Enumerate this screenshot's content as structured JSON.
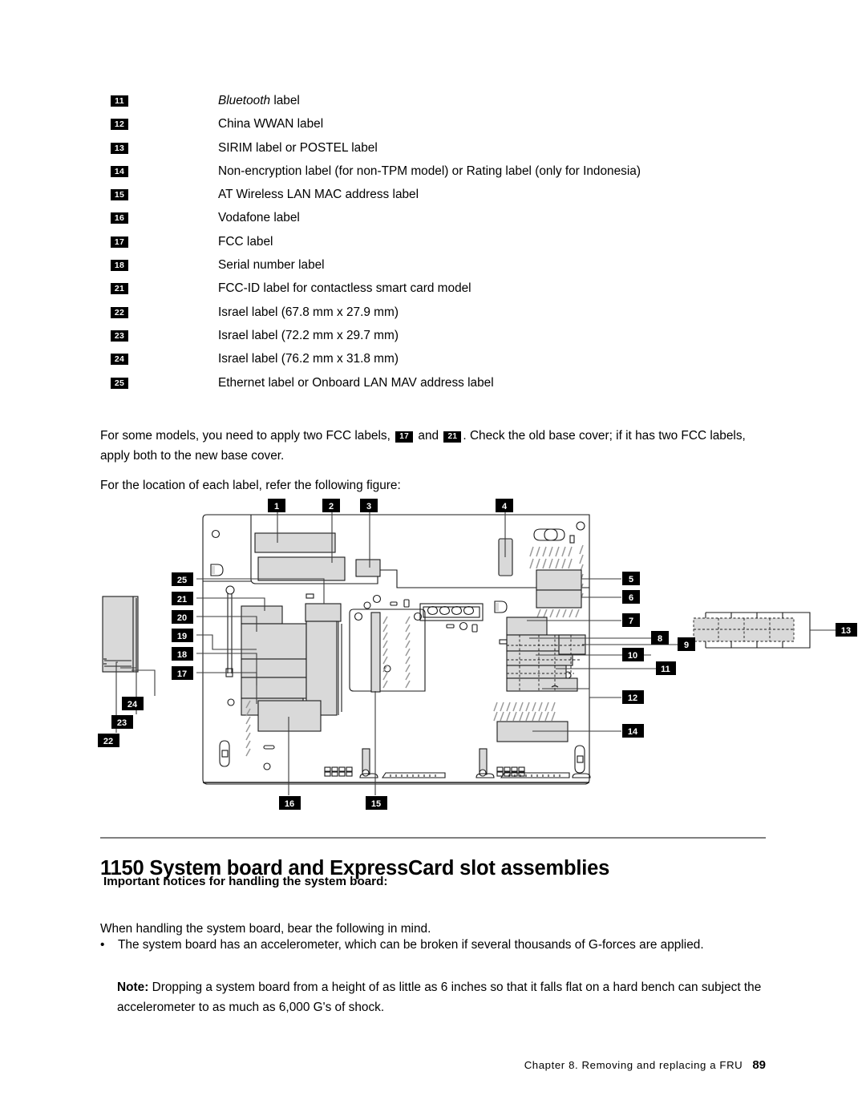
{
  "document": {
    "page_number": "89",
    "footer_text": "Chapter 8.  Removing  and  replacing a FRU"
  },
  "label_list": {
    "rows": [
      {
        "num": "11",
        "text_pre": "",
        "text_italic": "Bluetooth",
        "text_post": " label",
        "text": "Bluetooth label"
      },
      {
        "num": "12",
        "text": "China WWAN label"
      },
      {
        "num": "13",
        "text": "SIRIM label or POSTEL label"
      },
      {
        "num": "14",
        "text": "Non-encryption label (for non-TPM model) or Rating label (only for Indonesia)"
      },
      {
        "num": "15",
        "text": "AT Wireless LAN MAC address label"
      },
      {
        "num": "16",
        "text": "Vodafone label"
      },
      {
        "num": "17",
        "text": "FCC label"
      },
      {
        "num": "18",
        "text": "Serial number label"
      },
      {
        "num": "21",
        "text": "FCC-ID label for contactless smart card model"
      },
      {
        "num": "22",
        "text": "Israel label (67.8 mm x 27.9 mm)"
      },
      {
        "num": "23",
        "text": "Israel label (72.2 mm x 29.7 mm)"
      },
      {
        "num": "24",
        "text": "Israel label (76.2 mm x 31.8 mm)"
      },
      {
        "num": "25",
        "text": "Ethernet label or Onboard LAN MAV address label"
      }
    ]
  },
  "paragraphs": {
    "fcc_part1": "For some models, you need to apply two FCC labels,",
    "fcc_badge_a": "17",
    "fcc_conjunction": "and",
    "fcc_badge_b": "21",
    "fcc_part2": ". Check the old base cover; if it has two FCC labels, apply both to the new base cover.",
    "location": "For the location of each label, refer the following figure:"
  },
  "figure": {
    "callouts": [
      {
        "num": "1"
      },
      {
        "num": "2"
      },
      {
        "num": "3"
      },
      {
        "num": "4"
      },
      {
        "num": "5"
      },
      {
        "num": "6"
      },
      {
        "num": "7"
      },
      {
        "num": "8"
      },
      {
        "num": "9"
      },
      {
        "num": "10"
      },
      {
        "num": "11"
      },
      {
        "num": "12"
      },
      {
        "num": "13"
      },
      {
        "num": "14"
      },
      {
        "num": "15"
      },
      {
        "num": "16"
      },
      {
        "num": "17"
      },
      {
        "num": "18"
      },
      {
        "num": "19"
      },
      {
        "num": "20"
      },
      {
        "num": "21"
      },
      {
        "num": "22"
      },
      {
        "num": "23"
      },
      {
        "num": "24"
      },
      {
        "num": "25"
      }
    ],
    "colors": {
      "outline": "#1a1a1a",
      "component_fill": "#d9d9d9",
      "badge_bg": "#000000",
      "badge_text": "#ffffff"
    }
  },
  "section": {
    "heading": "1150 System board and ExpressCard slot assemblies",
    "subheading": "Important notices for handling the system board:",
    "handling_intro": "When handling the system board, bear the following in mind.",
    "bullet_dot": "•",
    "bullet_accelerometer": "The system board has an accelerometer, which can be broken if several thousands of G-forces are applied.",
    "note_label": "Note:",
    "note_body": " Dropping a system board from a height of as little as 6 inches so that it falls flat on a hard bench can subject the accelerometer to as much as 6,000 G's of shock."
  }
}
